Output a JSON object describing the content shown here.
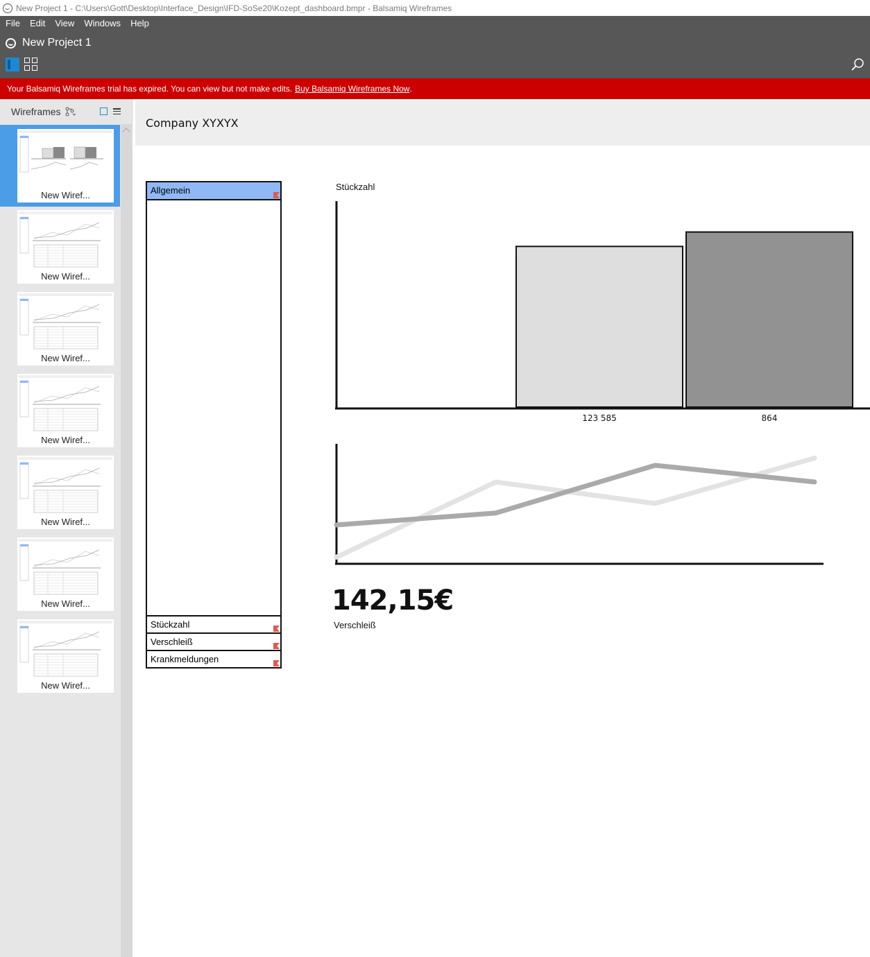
{
  "window": {
    "title": "New Project 1 - C:\\Users\\Gott\\Desktop\\Interface_Design\\IFD-SoSe20\\Kozept_dashboard.bmpr - Balsamiq Wireframes"
  },
  "menu": [
    "File",
    "Edit",
    "View",
    "Windows",
    "Help"
  ],
  "project": {
    "name": "New Project 1"
  },
  "banner": {
    "message": "Your Balsamiq Wireframes trial has expired. You can view but not make edits.",
    "link": "Buy Balsamiq Wireframes Now",
    "suffix": "."
  },
  "sidebar": {
    "title": "Wireframes",
    "thumbnails": [
      {
        "label": "New Wiref..."
      },
      {
        "label": "New Wiref..."
      },
      {
        "label": "New Wiref..."
      },
      {
        "label": "New Wiref..."
      },
      {
        "label": "New Wiref..."
      },
      {
        "label": "New Wiref..."
      },
      {
        "label": "New Wiref..."
      }
    ]
  },
  "wireframe": {
    "company": "Company XYXYX",
    "accordion": {
      "header": "Allgemein",
      "items": [
        "Stückzahl",
        "Verschleiß",
        "Krankmeldungen"
      ]
    },
    "kpi": {
      "value": "142,15€",
      "label": "Verschleiß"
    }
  },
  "chart_data": [
    {
      "type": "bar",
      "ylabel": "Stückzahl",
      "categories": [
        "123 585",
        "864"
      ],
      "series": [
        {
          "values": [
            0.78,
            0.85
          ],
          "colors": [
            "#dedede",
            "#929292"
          ]
        }
      ]
    },
    {
      "type": "line",
      "x": [
        0,
        1,
        2,
        3
      ],
      "series": [
        {
          "values": [
            0.05,
            0.68,
            0.5,
            0.88
          ],
          "color": "#e3e3e3"
        },
        {
          "values": [
            0.32,
            0.42,
            0.82,
            0.68
          ],
          "color": "#aaaaaa"
        }
      ]
    }
  ],
  "colors": {
    "menu_bg": "#575757",
    "banner_bg": "#cc0000",
    "accent": "#1e88d3",
    "accordion_header": "#8fb8f5"
  }
}
